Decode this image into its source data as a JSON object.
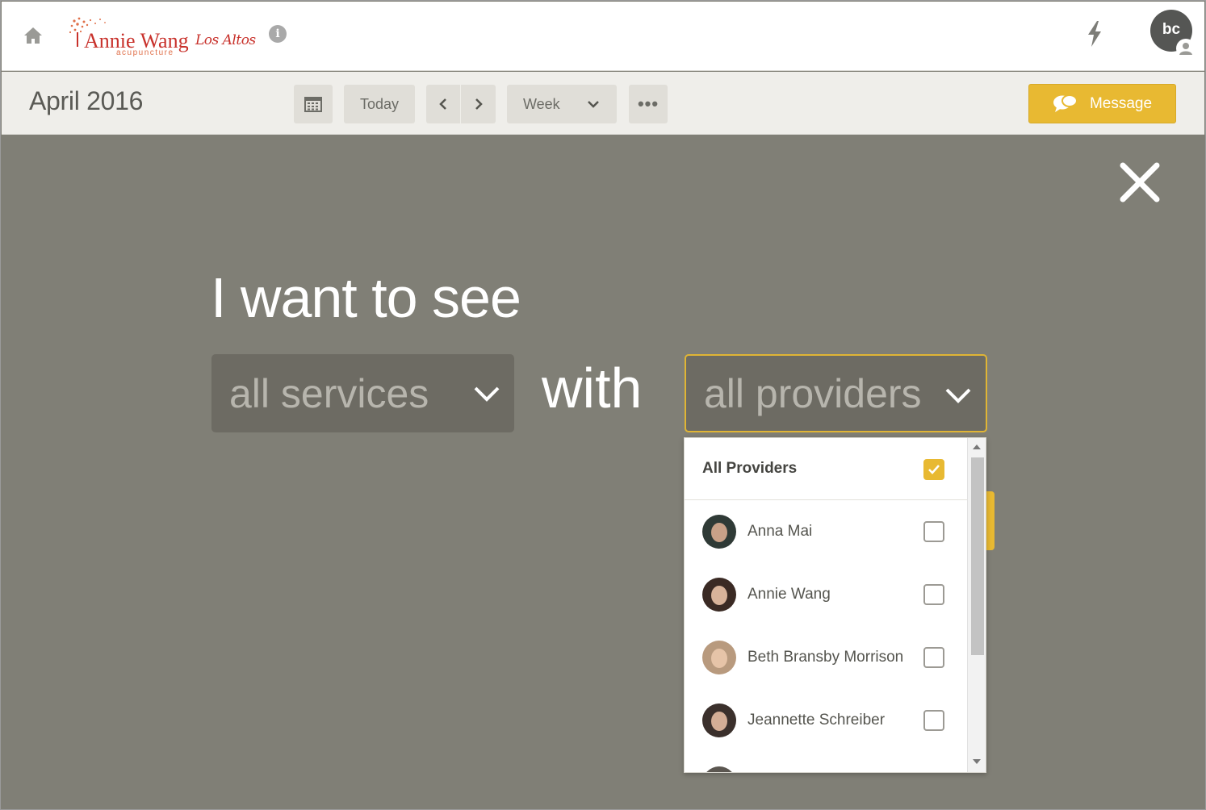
{
  "header": {
    "logo_main": "Annie Wang",
    "logo_script": "Los Altos",
    "logo_sub": "acupuncture",
    "avatar_initials": "bc"
  },
  "toolbar": {
    "month_title": "April 2016",
    "today_label": "Today",
    "view_label": "Week",
    "more_label": "•••",
    "message_label": "Message"
  },
  "overlay": {
    "headline": "I want to see",
    "services_value": "all services",
    "with_word": "with",
    "providers_value": "all providers"
  },
  "providers_dropdown": {
    "all_label": "All Providers",
    "all_checked": true,
    "items": [
      {
        "name": "Anna Mai",
        "checked": false
      },
      {
        "name": "Annie Wang",
        "checked": false
      },
      {
        "name": "Beth Bransby Morrison",
        "checked": false
      },
      {
        "name": "Jeannette Schreiber",
        "checked": false
      }
    ]
  },
  "colors": {
    "accent": "#e8b932",
    "overlay_bg": "#807f76",
    "brand_red": "#c8312b"
  }
}
